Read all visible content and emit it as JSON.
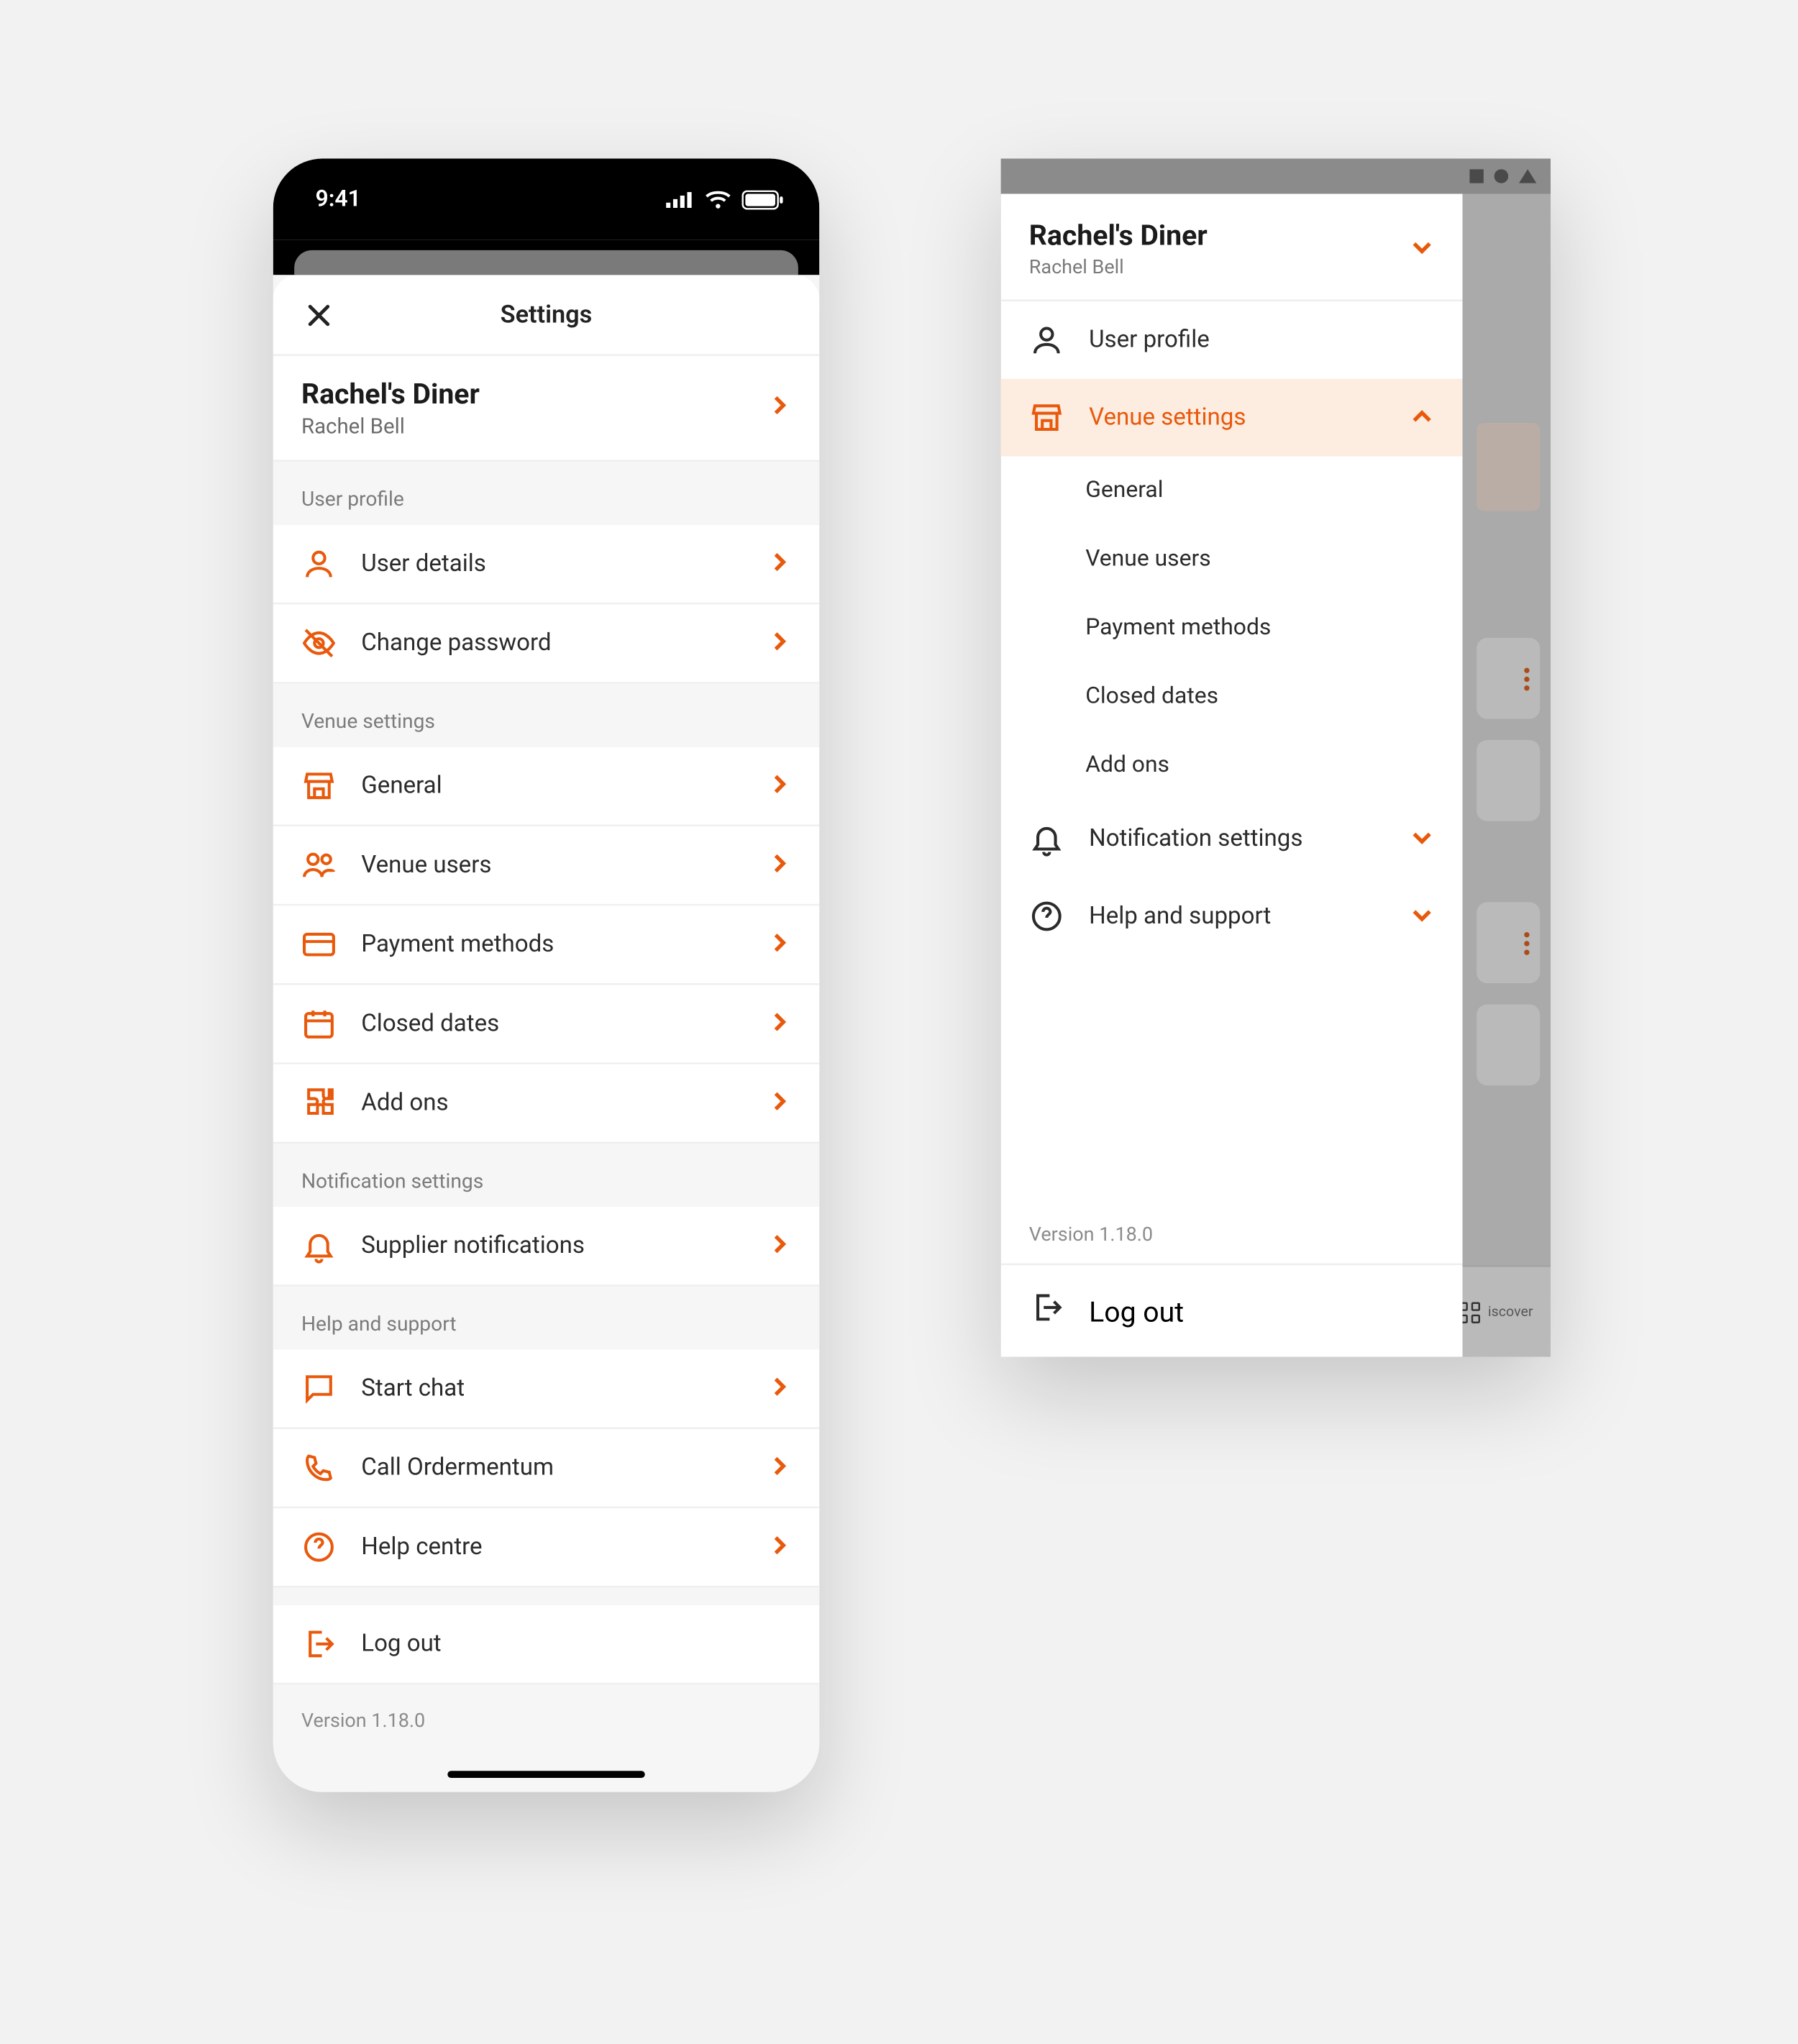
{
  "status": {
    "time": "9:41"
  },
  "colors": {
    "accent": "#E8590C"
  },
  "mobile": {
    "title": "Settings",
    "venue": {
      "name": "Rachel's Diner",
      "user": "Rachel Bell"
    },
    "sections": {
      "user_profile": {
        "label": "User profile",
        "user_details": "User details",
        "change_password": "Change password"
      },
      "venue_settings": {
        "label": "Venue settings",
        "general": "General",
        "venue_users": "Venue users",
        "payment_methods": "Payment methods",
        "closed_dates": "Closed dates",
        "add_ons": "Add ons"
      },
      "notifications": {
        "label": "Notification settings",
        "supplier_notifications": "Supplier notifications"
      },
      "help": {
        "label": "Help and support",
        "start_chat": "Start chat",
        "call": "Call Ordermentum",
        "help_centre": "Help centre"
      }
    },
    "logout": "Log out",
    "version": "Version 1.18.0"
  },
  "tablet": {
    "venue": {
      "name": "Rachel's Diner",
      "user": "Rachel Bell"
    },
    "items": {
      "user_profile": "User profile",
      "venue_settings": "Venue settings",
      "notification_settings": "Notification settings",
      "help_and_support": "Help and support"
    },
    "venue_sub": {
      "general": "General",
      "venue_users": "Venue users",
      "payment_methods": "Payment methods",
      "closed_dates": "Closed dates",
      "add_ons": "Add ons"
    },
    "version": "Version 1.18.0",
    "logout": "Log out",
    "footer_label": "iscover"
  }
}
